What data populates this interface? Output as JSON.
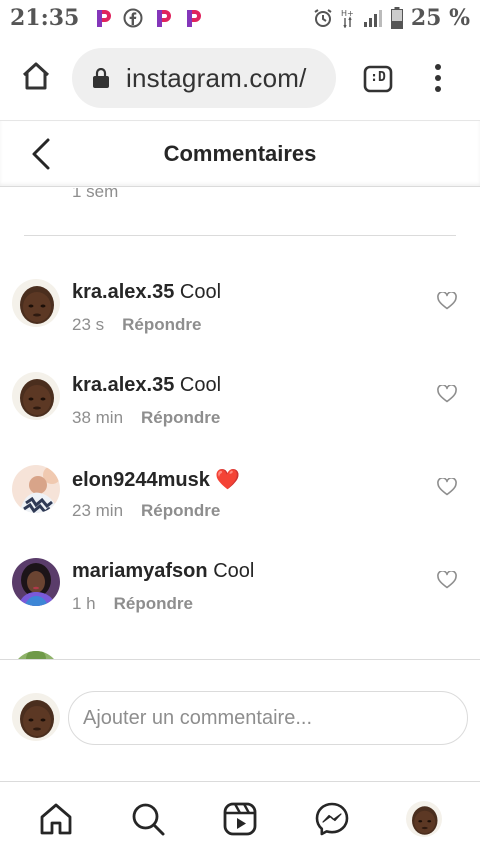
{
  "status_bar": {
    "time": "21:35",
    "battery": "25 %",
    "notification_icons": [
      "p-app-icon",
      "facebook-icon",
      "p-app-icon",
      "p-app-icon"
    ]
  },
  "browser": {
    "url": "instagram.com/",
    "tab_label": ":D"
  },
  "header": {
    "title": "Commentaires"
  },
  "comments": {
    "previous_time": "1 sem",
    "items": [
      {
        "username": "kra.alex.35",
        "text": "Cool",
        "time": "23 s",
        "reply": "Répondre"
      },
      {
        "username": "kra.alex.35",
        "text": "Cool",
        "time": "38 min",
        "reply": "Répondre"
      },
      {
        "username": "elon9244musk",
        "text": "❤️",
        "time": "23 min",
        "reply": "Répondre"
      },
      {
        "username": "mariamyafson",
        "text": "Cool",
        "time": "1 h",
        "reply": "Répondre"
      }
    ]
  },
  "add_comment": {
    "placeholder": "Ajouter un commentaire..."
  },
  "colors": {
    "text": "#262626",
    "secondary_text": "#8e8e8e",
    "divider": "#dbdbdb",
    "heart": "#ed4956"
  }
}
